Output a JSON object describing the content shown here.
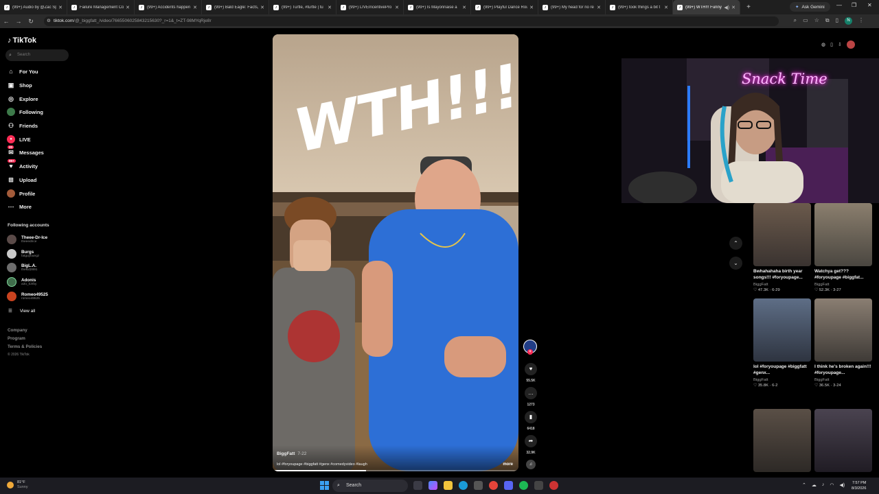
{
  "browser": {
    "tabs": [
      {
        "label": "(99+) Audio by @Zac Sp",
        "active": false
      },
      {
        "label": "Failure Management Co",
        "active": false
      },
      {
        "label": "(99+) Accidents happen",
        "active": false
      },
      {
        "label": "(99+) Bald Eagle: Facts,",
        "active": false
      },
      {
        "label": "(99+) Turtle, #turtle | tu",
        "active": false
      },
      {
        "label": "(99+) LIVEIncentivePro",
        "active": false
      },
      {
        "label": "(99+) Is Mayonnaise a",
        "active": false
      },
      {
        "label": "(99+) Playful Dance Rou",
        "active": false
      },
      {
        "label": "(99+) My head for no re",
        "active": false
      },
      {
        "label": "(99+) took things a bit t",
        "active": false
      },
      {
        "label": "(99+) WTH!!! Funny",
        "active": true
      }
    ],
    "ask_gemini": "Ask Gemini",
    "url_host": "tiktok.com",
    "url_path": "/@_biggfatt_/video/7665506025843215630?_r=1&_t=ZT-98MYqRje8r",
    "account_initial": "N"
  },
  "sidebar": {
    "logo": "TikTok",
    "search_placeholder": "Search",
    "nav": [
      {
        "label": "For You",
        "icon": "home-icon"
      },
      {
        "label": "Shop",
        "icon": "shop-icon"
      },
      {
        "label": "Explore",
        "icon": "compass-icon"
      },
      {
        "label": "Following",
        "icon": "following-avatar-icon"
      },
      {
        "label": "Friends",
        "icon": "friends-icon"
      },
      {
        "label": "LIVE",
        "icon": "live-icon"
      },
      {
        "label": "Messages",
        "icon": "messages-icon",
        "badge": "20"
      },
      {
        "label": "Activity",
        "icon": "activity-icon",
        "badge": "99+"
      },
      {
        "label": "Upload",
        "icon": "upload-icon"
      },
      {
        "label": "Profile",
        "icon": "profile-icon"
      },
      {
        "label": "More",
        "icon": "more-icon"
      }
    ],
    "following_title": "Following accounts",
    "following": [
      {
        "name": "Theee-Dr-Ice",
        "handle": "theeedrice"
      },
      {
        "name": "Burgs",
        "handle": "fatguybuegz"
      },
      {
        "name": "BigL.A.",
        "handle": "thekid2891"
      },
      {
        "name": "Adonis",
        "handle": "a3o_k3rby"
      },
      {
        "name": "Romeo49525",
        "handle": "romeo49525"
      }
    ],
    "view_all": "View all",
    "footer": [
      "Company",
      "Program",
      "Terms & Policies"
    ],
    "copyright": "© 2026 TikTok"
  },
  "video": {
    "overlay_text": "WTH!!!",
    "author": "BiggFatt",
    "date": "7-22",
    "description": "lol #foryoupage #biggfatt #genx #comedyvideo #laugh",
    "more": "more",
    "progress": 0.38
  },
  "actions": {
    "likes": "55.5K",
    "comments": "1273",
    "saves": "6418",
    "shares": "32.9K"
  },
  "webcam": {
    "neon_sign": "Snack Time"
  },
  "related": [
    {
      "title": "Bwhahahaha birth year songs!!! #foryoupage...",
      "author": "BiggFatt",
      "likes": "47.3K",
      "date": "6-29"
    },
    {
      "title": "Watchya get??? #foryoupage #biggfat...",
      "author": "BiggFatt",
      "likes": "52.3K",
      "date": "3-27"
    },
    {
      "title": "lol #foryoupage #biggfatt #genx...",
      "author": "BiggFatt",
      "likes": "35.8K",
      "date": "6-2"
    },
    {
      "title": "I think he's broken again!!! #foryoupage...",
      "author": "BiggFatt",
      "likes": "36.5K",
      "date": "3-24"
    },
    {
      "title": "",
      "author": "",
      "likes": "",
      "date": ""
    },
    {
      "title": "",
      "author": "",
      "likes": "",
      "date": ""
    }
  ],
  "taskbar": {
    "temp": "81°F",
    "weather": "Sunny",
    "search": "Search",
    "time": "7:57 PM",
    "date": "8/3/2026"
  }
}
